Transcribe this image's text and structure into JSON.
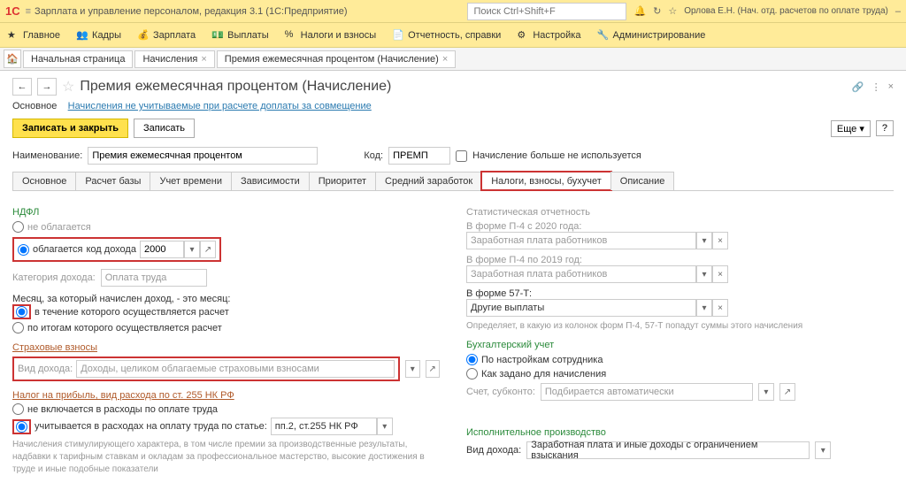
{
  "header": {
    "app_title": "Зарплата и управление персоналом, редакция 3.1  (1С:Предприятие)",
    "search_placeholder": "Поиск Ctrl+Shift+F",
    "user": "Орлова Е.Н. (Нач. отд. расчетов по оплате труда)"
  },
  "menu": [
    "Главное",
    "Кадры",
    "Зарплата",
    "Выплаты",
    "Налоги и взносы",
    "Отчетность, справки",
    "Настройка",
    "Администрирование"
  ],
  "tabs": {
    "t0": "Начальная страница",
    "t1": "Начисления",
    "t2": "Премия ежемесячная процентом (Начисление)"
  },
  "page": {
    "title": "Премия ежемесячная процентом (Начисление)",
    "sub_main": "Основное",
    "sub_link": "Начисления не учитываемые при расчете доплаты за совмещение",
    "save_close": "Записать и закрыть",
    "save": "Записать",
    "more": "Еще",
    "help": "?",
    "name_label": "Наименование:",
    "name_value": "Премия ежемесячная процентом",
    "code_label": "Код:",
    "code_value": "ПРЕМП",
    "deprecated": "Начисление больше не используется"
  },
  "inner_tabs": [
    "Основное",
    "Расчет базы",
    "Учет времени",
    "Зависимости",
    "Приоритет",
    "Средний заработок",
    "Налоги, взносы, бухучет",
    "Описание"
  ],
  "left": {
    "ndfl": "НДФЛ",
    "not_taxed": "не облагается",
    "taxed": "облагается",
    "income_code_label": "код дохода",
    "income_code": "2000",
    "income_cat_label": "Категория дохода:",
    "income_cat": "Оплата труда",
    "month_label": "Месяц, за который начислен доход, - это месяц:",
    "month_opt1": "в течение которого осуществляется расчет",
    "month_opt2": "по итогам которого осуществляется расчет",
    "insurance": "Страховые взносы",
    "income_type_label": "Вид дохода:",
    "income_type": "Доходы, целиком облагаемые страховыми взносами",
    "profit_tax": "Налог на прибыль, вид расхода по ст. 255 НК РФ",
    "profit_opt1": "не включается в расходы по оплате труда",
    "profit_opt2": "учитывается в расходах на оплату труда по статье:",
    "profit_article": "пп.2, ст.255 НК РФ",
    "note": "Начисления стимулирующего характера, в том числе премии за производственные результаты, надбавки к тарифным ставкам и окладам за профессиональное мастерство, высокие достижения в труде и иные подобные показатели"
  },
  "right": {
    "stat": "Статистическая отчетность",
    "p4_2020": "В форме П-4 с 2020 года:",
    "p4_2020_val": "Заработная плата работников",
    "p4_2019": "В форме П-4 по 2019 год:",
    "p4_2019_val": "Заработная плата работников",
    "f57t": "В форме 57-Т:",
    "f57t_val": "Другие выплаты",
    "f57t_note": "Определяет, в какую из колонок форм П-4, 57-Т попадут суммы этого начисления",
    "acc": "Бухгалтерский учет",
    "acc_opt1": "По настройкам сотрудника",
    "acc_opt2": "Как задано для начисления",
    "acc_sub_label": "Счет, субконто:",
    "acc_sub_val": "Подбирается автоматически",
    "enforce": "Исполнительное производство",
    "enforce_label": "Вид дохода:",
    "enforce_val": "Заработная плата и иные доходы с ограничением взыскания"
  }
}
